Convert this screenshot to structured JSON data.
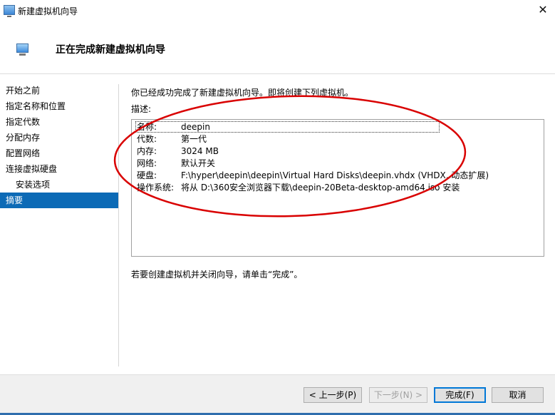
{
  "window": {
    "title": "新建虚拟机向导",
    "close_glyph": "✕"
  },
  "header": {
    "title": "正在完成新建虚拟机向导"
  },
  "nav": {
    "items": [
      {
        "label": "开始之前"
      },
      {
        "label": "指定名称和位置"
      },
      {
        "label": "指定代数"
      },
      {
        "label": "分配内存"
      },
      {
        "label": "配置网络"
      },
      {
        "label": "连接虚拟硬盘"
      },
      {
        "label": "安装选项"
      },
      {
        "label": "摘要"
      }
    ],
    "active_item": "摘要"
  },
  "main": {
    "intro": "你已经成功完成了新建虚拟机向导。即将创建下列虚拟机。",
    "desc_label": "描述:",
    "rows": [
      {
        "key": "名称:",
        "value": "deepin"
      },
      {
        "key": "代数:",
        "value": "第一代"
      },
      {
        "key": "内存:",
        "value": "3024 MB"
      },
      {
        "key": "网络:",
        "value": "默认开关"
      },
      {
        "key": "硬盘:",
        "value": "F:\\hyper\\deepin\\deepin\\Virtual Hard Disks\\deepin.vhdx (VHDX, 动态扩展)"
      },
      {
        "key": "操作系统:",
        "value": "将从 D:\\360安全浏览器下载\\deepin-20Beta-desktop-amd64.iso 安装"
      }
    ],
    "hint": "若要创建虚拟机并关闭向导，请单击“完成”。"
  },
  "buttons": {
    "prev": "< 上一步(P)",
    "next": "下一步(N) >",
    "finish": "完成(F)",
    "cancel": "取消"
  },
  "colors": {
    "accent": "#0c6ab6",
    "annotation": "#d90000"
  }
}
